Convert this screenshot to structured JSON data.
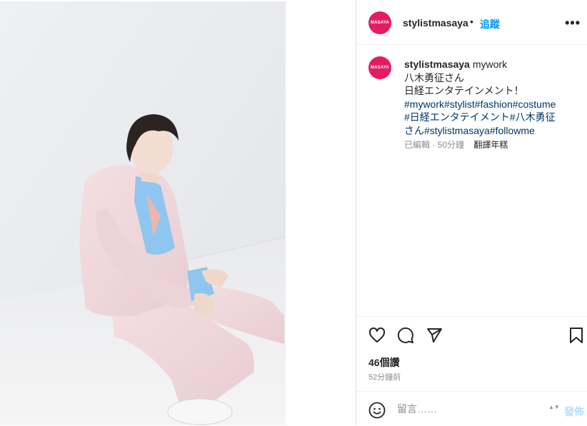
{
  "header": {
    "avatar_text": "MASAYA",
    "username": "stylistmasaya",
    "separator": "•",
    "follow_label": "追蹤",
    "more_label": "•••"
  },
  "caption": {
    "avatar_text": "MASAYA",
    "username": "stylistmasaya",
    "lines": [
      "mywork",
      "八木勇征さん",
      "日経エンタテインメント！",
      "#mywork#stylist#fashion#costume",
      "#日経エンタテイメント#八木勇征",
      "さん#stylistmasaya#followme"
    ],
    "edited_time": "已編輯 · 50分鐘",
    "translate_label": "翻譯年糕"
  },
  "actions": {
    "like_icon": "heart-icon",
    "comment_icon": "comment-icon",
    "share_icon": "share-icon",
    "save_icon": "bookmark-icon"
  },
  "stats": {
    "likes": "46個讚",
    "posted_time": "52分鐘前"
  },
  "comment": {
    "placeholder": "留言……",
    "post_label": "發佈",
    "spinner": "▲▼"
  },
  "colors": {
    "accent": "#0095f6",
    "avatar": "#e31c62",
    "hashtag": "#00376b"
  }
}
